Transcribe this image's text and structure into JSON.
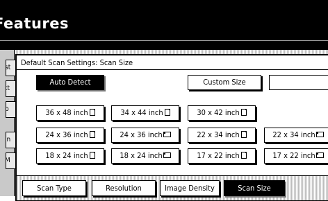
{
  "header": {
    "title": "Features"
  },
  "side_tabs": [
    {
      "label": "st"
    },
    {
      "label": "tt"
    },
    {
      "label": "p"
    },
    {
      "label": "in"
    },
    {
      "label": "M"
    }
  ],
  "dialog": {
    "title": "Default Scan Settings: Scan Size",
    "auto_detect_label": "Auto Detect",
    "custom_size_label": "Custom Size",
    "custom_size_value": "",
    "selected": "Auto Detect",
    "sizes": [
      {
        "label": "36 x 48 inch",
        "orientation": "portrait"
      },
      {
        "label": "34 x 44 inch",
        "orientation": "portrait"
      },
      {
        "label": "30 x 42 inch",
        "orientation": "portrait"
      },
      {
        "label": "24 x 36 inch",
        "orientation": "portrait"
      },
      {
        "label": "24 x 36 inch",
        "orientation": "landscape"
      },
      {
        "label": "22 x 34 inch",
        "orientation": "portrait"
      },
      {
        "label": "22 x 34 inch",
        "orientation": "landscape"
      },
      {
        "label": "18 x 24 inch",
        "orientation": "portrait"
      },
      {
        "label": "18 x 24 inch",
        "orientation": "landscape"
      },
      {
        "label": "17 x 22 inch",
        "orientation": "portrait"
      },
      {
        "label": "17 x 22 inch",
        "orientation": "landscape"
      }
    ]
  },
  "tabs": [
    {
      "label": "Scan Type",
      "selected": false
    },
    {
      "label": "Resolution",
      "selected": false
    },
    {
      "label": "Image Density",
      "selected": false
    },
    {
      "label": "Scan Size",
      "selected": true
    }
  ]
}
